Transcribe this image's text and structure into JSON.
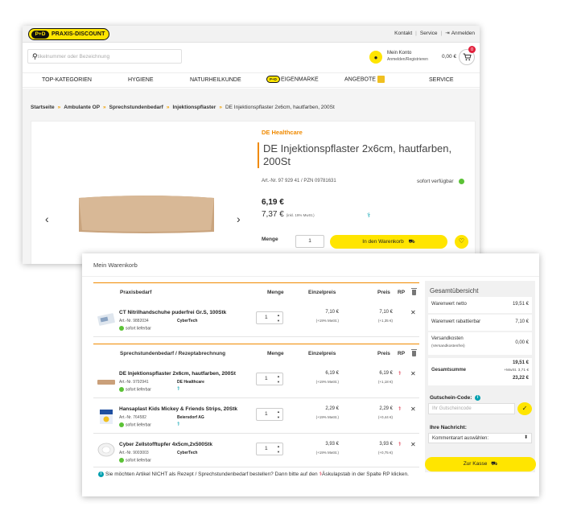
{
  "product_page": {
    "logo": {
      "badge": "P+D",
      "text": "PRAXIS-DISCOUNT"
    },
    "toplinks": [
      "Kontakt",
      "Service",
      "Anmelden"
    ],
    "search": {
      "placeholder": "Artikelnummer oder Bezeichnung"
    },
    "account": {
      "line1": "Mein Konto",
      "line2": "Anmelden/Registrieren"
    },
    "cart": {
      "total": "0,00 €",
      "count": "0"
    },
    "nav": [
      "TOP-KATEGORIEN",
      "HYGIENE",
      "NATURHEILKUNDE",
      "EIGENMARKE",
      "ANGEBOTE",
      "SERVICE"
    ],
    "nav_badge": "P+D",
    "breadcrumb": [
      "Startseite",
      "Ambulante OP",
      "Sprechstundenbedarf",
      "Injektionspflaster",
      "DE Injektionspflaster 2x6cm, hautfarben, 200St"
    ],
    "product": {
      "brand": "DE Healthcare",
      "title": "DE Injektionspflaster 2x6cm, hautfarben, 200St",
      "artnr": "Art.-Nr. 97 929 41 / PZN 09781631",
      "availability": "sofort verfügbar",
      "price_net": "6,19 €",
      "price_gross": "7,37 €",
      "price_gross_note": "(inkl. 19% MwSt.)",
      "quantity_label": "Menge",
      "quantity": "1",
      "add_to_cart": "In den Warenkorb"
    }
  },
  "cart_page": {
    "title": "Mein Warenkorb",
    "sections": [
      {
        "name": "Praxisbedarf",
        "cols": {
          "qty": "Menge",
          "unit": "Einzelpreis",
          "price": "Preis",
          "rp": "RP"
        },
        "items": [
          {
            "name": "CT Nitrilhandschuhe puderfrei Gr.S, 100Stk",
            "artnr": "Art.-Nr. 9882034",
            "maker": "CyberTech",
            "avail": "sofort lieferbar",
            "qty": "1",
            "unit": "7,10 €",
            "unit_sub": "(+19% MwSt.)",
            "price": "7,10 €",
            "price_sub": "(+1,35 €)"
          }
        ]
      },
      {
        "name": "Sprechstundenbedarf / Rezeptabrechnung",
        "cols": {
          "qty": "Menge",
          "unit": "Einzelpreis",
          "price": "Preis",
          "rp": "RP"
        },
        "items": [
          {
            "name": "DE Injektionspflaster 2x6cm, hautfarben, 200St",
            "artnr": "Art.-Nr. 9792941",
            "maker": "DE Healthcare",
            "avail": "sofort lieferbar",
            "qty": "1",
            "unit": "6,19 €",
            "unit_sub": "(+19% MwSt.)",
            "price": "6,19 €",
            "price_sub": "(+1,18 €)"
          },
          {
            "name": "Hansaplast Kids Mickey & Friends Strips, 20Stk",
            "artnr": "Art.-Nr. 764582",
            "maker": "Beiersdorf AG",
            "avail": "sofort lieferbar",
            "qty": "1",
            "unit": "2,29 €",
            "unit_sub": "(+19% MwSt.)",
            "price": "2,29 €",
            "price_sub": "(+0,44 €)"
          },
          {
            "name": "Cyber Zellstofftupfer 4x5cm,2x500Stk",
            "artnr": "Art.-Nr. 9003003",
            "maker": "CyberTech",
            "avail": "sofort lieferbar",
            "qty": "1",
            "unit": "3,93 €",
            "unit_sub": "(+19% MwSt.)",
            "price": "3,93 €",
            "price_sub": "(+0,75 €)"
          }
        ]
      }
    ],
    "note_pre": "Sie möchten Artikel NICHT als Rezept / Sprechstundenbedarf bestellen? Dann bitte auf den",
    "note_post": "Äskulapstab in der Spalte RP klicken.",
    "summary": {
      "title": "Gesamtübersicht",
      "rows": [
        {
          "label": "Warenwert netto",
          "value": "19,51 €"
        },
        {
          "label": "Warenwert rabattierbar",
          "value": "7,10 €"
        },
        {
          "label": "Versandkosten",
          "sub": "(Versandkostenfrei)",
          "value": "0,00 €"
        }
      ],
      "total_label": "Gesamtsumme",
      "total_net": "19,51 €",
      "total_tax": "+MwSt. 3,71 €",
      "total_gross": "23,22 €",
      "coupon_label": "Gutschein-Code:",
      "coupon_placeholder": "Ihr Gutscheincode",
      "message_label": "Ihre Nachricht:",
      "message_select": "Kommentarart auswählen:",
      "checkout": "Zur Kasse"
    }
  },
  "colors": {
    "brand_yellow": "#ffe500",
    "accent_orange": "#f08a00",
    "rx_teal": "#00a0b0",
    "rx_red": "#d9213c",
    "available_green": "#5bc236"
  }
}
